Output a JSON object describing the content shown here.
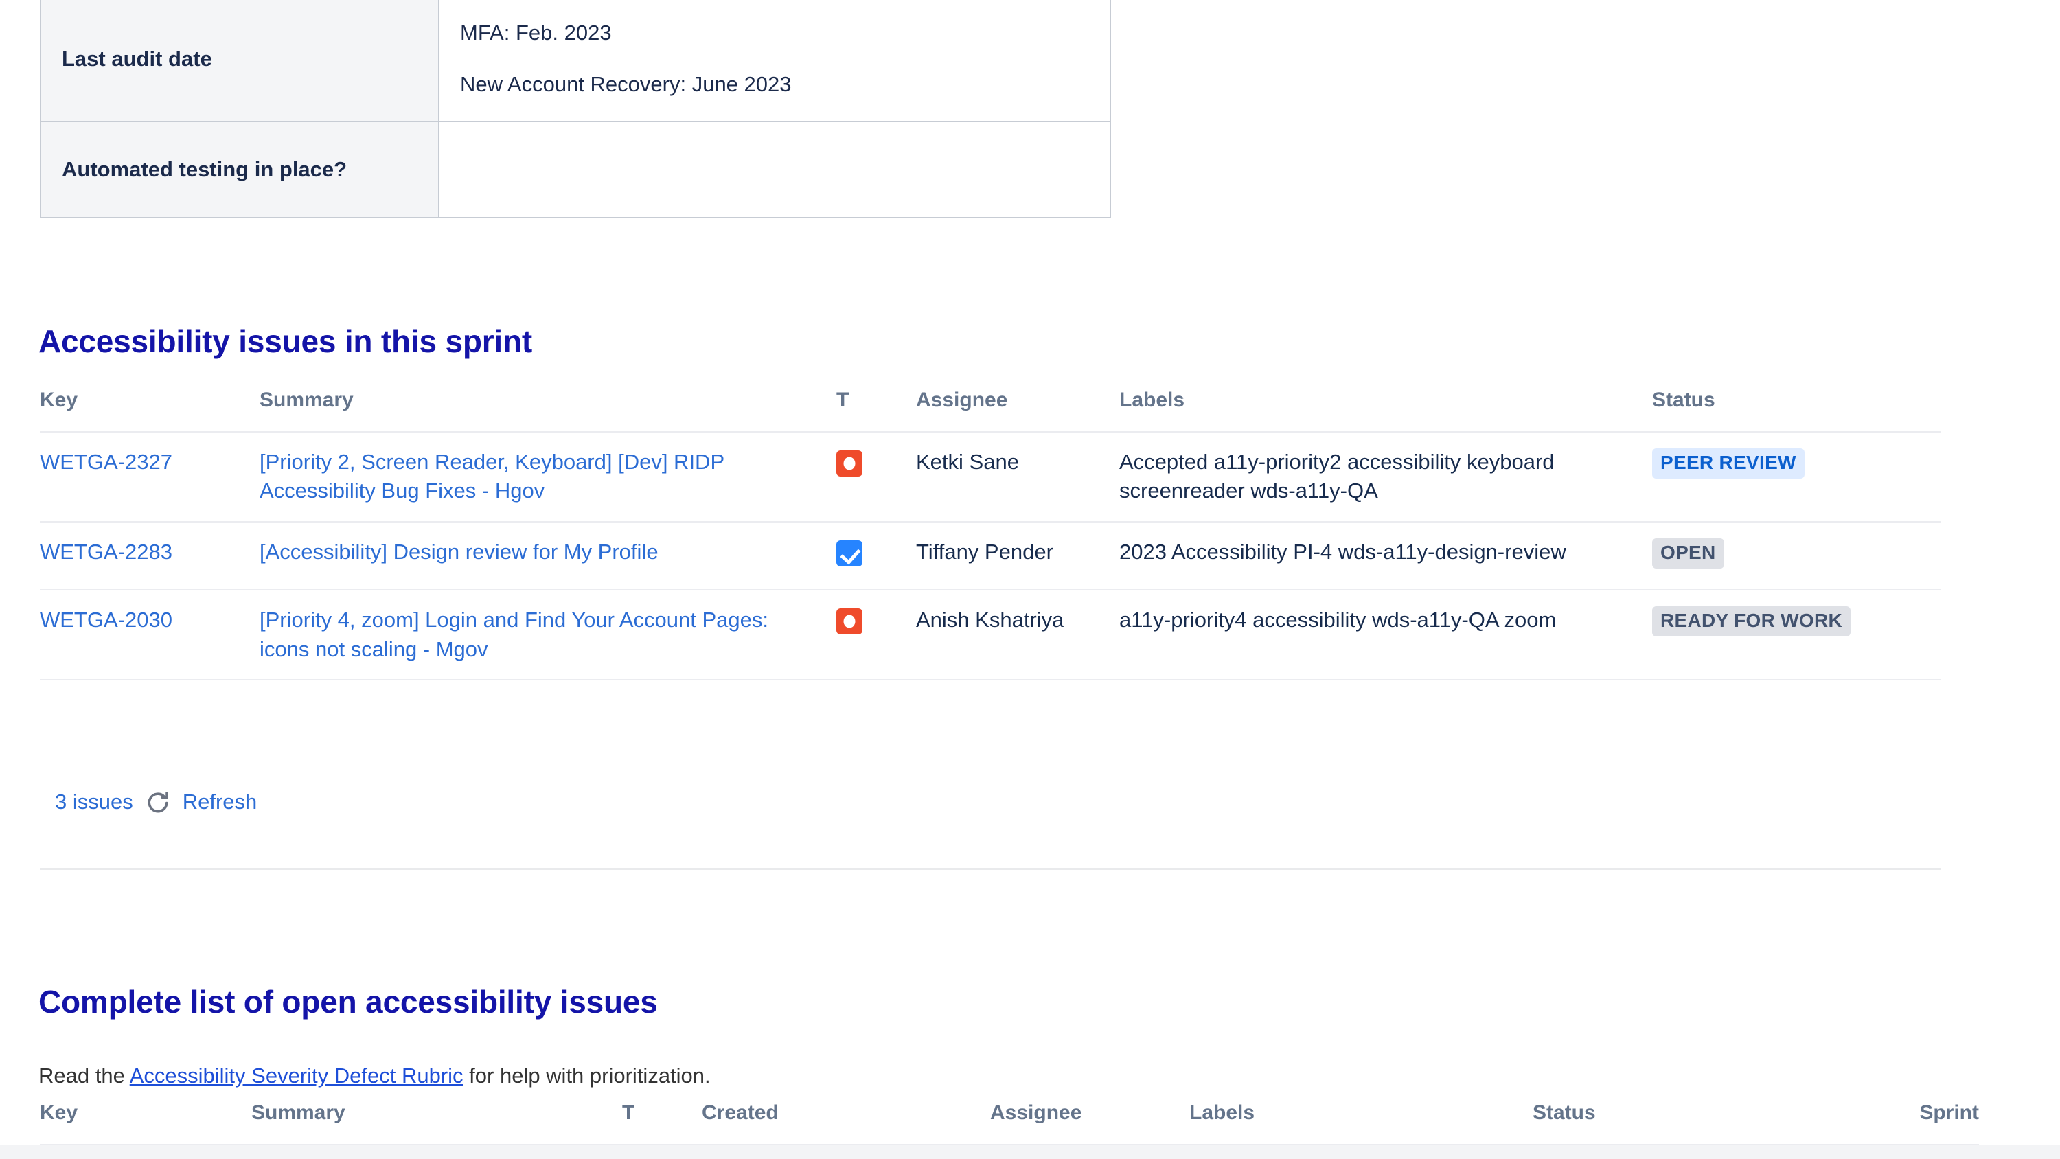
{
  "audit_table": {
    "rows": [
      {
        "label": "Last audit date",
        "values": [
          "MFA: Feb. 2023",
          "New Account Recovery: June 2023"
        ]
      },
      {
        "label": "Automated testing in place?",
        "values": [
          ""
        ]
      }
    ]
  },
  "sprint_section": {
    "heading": "Accessibility issues in this sprint",
    "columns": [
      "Key",
      "Summary",
      "T",
      "Assignee",
      "Labels",
      "Status"
    ],
    "rows": [
      {
        "key": "WETGA-2327",
        "summary": "[Priority 2, Screen Reader, Keyboard] [Dev] RIDP Accessibility Bug Fixes - Hgov",
        "type_icon": "bug-icon",
        "type_class": "bug",
        "assignee": "Ketki Sane",
        "labels": "Accepted a11y-priority2 accessibility keyboard screenreader wds-a11y-QA",
        "status": "PEER REVIEW",
        "status_class": "blue"
      },
      {
        "key": "WETGA-2283",
        "summary": "[Accessibility] Design review for My Profile",
        "type_icon": "task-icon",
        "type_class": "task",
        "assignee": "Tiffany Pender",
        "labels": "2023 Accessibility PI-4 wds-a11y-design-review",
        "status": "OPEN",
        "status_class": "grey"
      },
      {
        "key": "WETGA-2030",
        "summary": "[Priority 4, zoom] Login and Find Your Account Pages: icons not scaling - Mgov",
        "type_icon": "bug-icon",
        "type_class": "bug",
        "assignee": "Anish Kshatriya",
        "labels": "a11y-priority4 accessibility wds-a11y-QA zoom",
        "status": "READY FOR WORK",
        "status_class": "grey"
      }
    ],
    "footer": {
      "count_label": "3 issues",
      "refresh_label": "Refresh",
      "refresh_icon": "refresh-icon"
    }
  },
  "complete_section": {
    "heading": "Complete list of open accessibility issues",
    "intro_prefix": "Read the ",
    "intro_link": "Accessibility Severity Defect Rubric",
    "intro_suffix": " for help with prioritization.",
    "columns": [
      "Key",
      "Summary",
      "T",
      "Created",
      "Assignee",
      "Labels",
      "Status",
      "Sprint"
    ]
  },
  "colors": {
    "heading": "#1414a8",
    "link": "#2b6cd4",
    "bug": "#ef4b2b",
    "task": "#2684ff",
    "badge_blue_bg": "#deebff",
    "badge_blue_fg": "#0b5fce",
    "badge_grey_bg": "#dfe1e6",
    "badge_grey_fg": "#42526e",
    "table_header_text": "#64748b",
    "cell_bg": "#f4f5f7",
    "border": "#c7ccd4"
  }
}
